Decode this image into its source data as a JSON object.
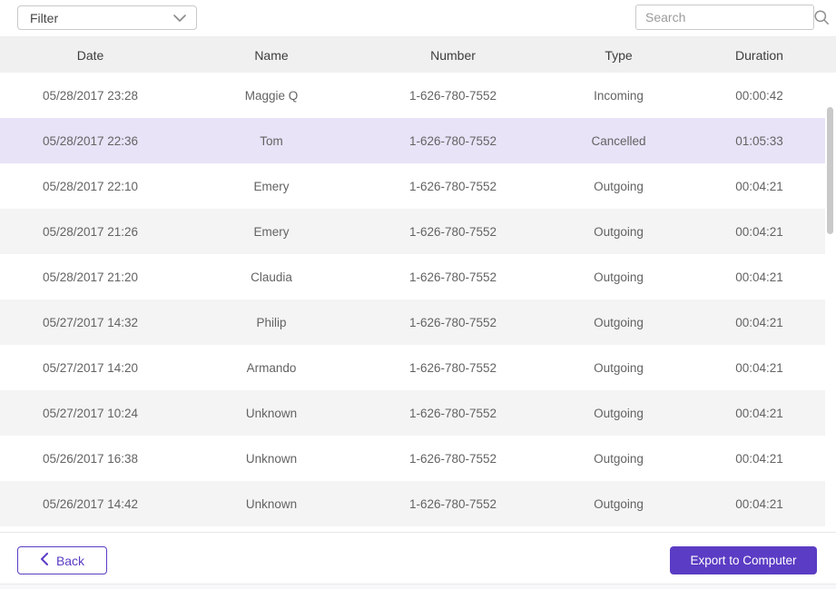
{
  "topbar": {
    "filter": {
      "label": "Filter"
    },
    "search": {
      "placeholder": "Search"
    }
  },
  "table": {
    "columns": [
      "Date",
      "Name",
      "Number",
      "Type",
      "Duration"
    ],
    "rows": [
      {
        "date": "05/28/2017 23:28",
        "name": "Maggie Q",
        "number": "1-626-780-7552",
        "type": "Incoming",
        "duration": "00:00:42",
        "state": "normal"
      },
      {
        "date": "05/28/2017 22:36",
        "name": "Tom",
        "number": "1-626-780-7552",
        "type": "Cancelled",
        "duration": "01:05:33",
        "state": "selected"
      },
      {
        "date": "05/28/2017 22:10",
        "name": "Emery",
        "number": "1-626-780-7552",
        "type": "Outgoing",
        "duration": "00:04:21",
        "state": "normal"
      },
      {
        "date": "05/28/2017 21:26",
        "name": "Emery",
        "number": "1-626-780-7552",
        "type": "Outgoing",
        "duration": "00:04:21",
        "state": "normal"
      },
      {
        "date": "05/28/2017 21:20",
        "name": "Claudia",
        "number": "1-626-780-7552",
        "type": "Outgoing",
        "duration": "00:04:21",
        "state": "normal"
      },
      {
        "date": "05/27/2017 14:32",
        "name": "Philip",
        "number": "1-626-780-7552",
        "type": "Outgoing",
        "duration": "00:04:21",
        "state": "normal"
      },
      {
        "date": "05/27/2017 14:20",
        "name": "Armando",
        "number": "1-626-780-7552",
        "type": "Outgoing",
        "duration": "00:04:21",
        "state": "normal"
      },
      {
        "date": "05/27/2017 10:24",
        "name": "Unknown",
        "number": "1-626-780-7552",
        "type": "Outgoing",
        "duration": "00:04:21",
        "state": "normal"
      },
      {
        "date": "05/26/2017 16:38",
        "name": "Unknown",
        "number": "1-626-780-7552",
        "type": "Outgoing",
        "duration": "00:04:21",
        "state": "normal"
      },
      {
        "date": "05/26/2017 14:42",
        "name": "Unknown",
        "number": "1-626-780-7552",
        "type": "Outgoing",
        "duration": "00:04:21",
        "state": "normal"
      }
    ]
  },
  "footer": {
    "back_label": "Back",
    "export_label": "Export to Computer"
  },
  "icons": {
    "filter_chevron": "chevron-down",
    "search": "magnifier",
    "back_chevron": "chevron-left"
  },
  "colors": {
    "accent": "#5b3cc4",
    "selected_row": "#e8e3f7",
    "zebra_row": "#f4f4f4",
    "header_bg": "#f0f0f0"
  }
}
